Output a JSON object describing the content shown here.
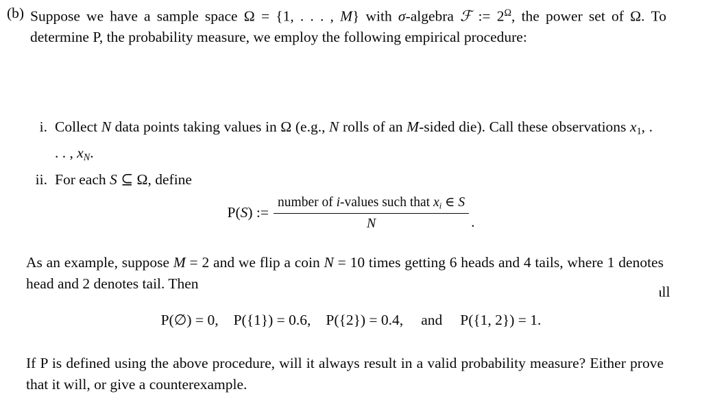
{
  "document": {
    "type": "math-homework-problem",
    "background_color": "#ffffff",
    "text_color": "#0a0a0a"
  },
  "part": {
    "label": "(b)",
    "line1_a": "Suppose we have a sample space ",
    "omega": "Ω",
    "eq": " = ",
    "set_spec": "{1, . . . , ",
    "M": "M",
    "set_close": "} with ",
    "sigma": "σ",
    "algebra_word": "-algebra ",
    "script_f": "ℱ",
    "assign": " := 2",
    "power_sup": "Ω",
    "line1_tail": ", the power set of ",
    "line2_tail": ". To determine P, the probability measure, we employ the following empirical procedure:"
  },
  "steps": [
    {
      "numeral": "i.",
      "text_a": "Collect ",
      "N": "N",
      "text_b": " data points taking values in ",
      "omega": "Ω",
      "text_c": " (e.g., ",
      "N2": "N",
      "text_d": " rolls of an ",
      "M": "M",
      "text_e": "-sided die). Call these observations ",
      "x1": "x",
      "x1sub": "1",
      "dots": ", . . . , ",
      "xN": "x",
      "xNsub": "N",
      "text_f": "."
    },
    {
      "numeral": "ii.",
      "text_a": "For each ",
      "S": "S",
      "subset": " ⊆ ",
      "omega": "Ω",
      "text_b": ", define"
    }
  ],
  "definition_equation": {
    "lhs_p": "P(",
    "lhs_s": "S",
    "lhs_close": ") :=",
    "numerator_a": "number of ",
    "numerator_i": "i",
    "numerator_b": "-values such that ",
    "numerator_x": "x",
    "numerator_xsub": "i",
    "numerator_in": " ∈ ",
    "numerator_S": "S",
    "denominator": "N",
    "trailing_punctuation": "."
  },
  "example_paragraph": {
    "text_a": "As an example, suppose ",
    "M": "M",
    "eq_m": " = 2",
    "text_b": " and we flip a coin ",
    "N": "N",
    "eq_n": " = 10",
    "text_c": " times getting 6 heads and 4 tails, where 1 denotes head and 2 denotes tail. Then"
  },
  "values_equation": {
    "empty_set": "P(∅) = 0,",
    "singleton_one": "P({1}) = 0.6,",
    "singleton_two": "P({2}) = 0.4,",
    "conjunction": "and",
    "full_set": "P({1, 2}) = 1."
  },
  "question_paragraph": {
    "text": "If P is defined using the above procedure, will it always result in a valid probability measure? Either prove that it will, or give a counterexample."
  },
  "artifact": {
    "fragment": "all"
  }
}
